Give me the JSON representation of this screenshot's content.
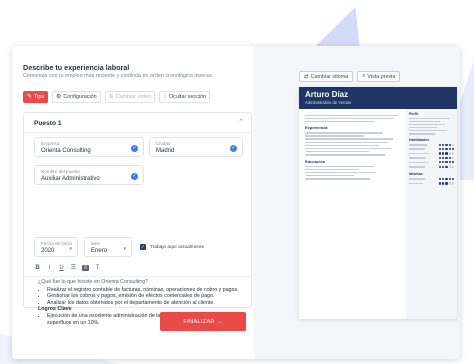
{
  "form": {
    "title": "Describe tu experiencia laboral",
    "subtitle": "Comienza con tu empleo más reciente y continúa en orden cronológico inverso.",
    "toolbar": {
      "tips": "Tips",
      "config": "Configuración",
      "change_order": "Cambiar orden",
      "hide_section": "Ocultar sección"
    },
    "job": {
      "heading": "Puesto 1",
      "empresa_label": "Empresa",
      "empresa_value": "Orienta Consulting",
      "ciudad_label": "Ciudad",
      "ciudad_value": "Madrid",
      "puesto_label": "Nombre del puesto",
      "puesto_value": "Auxiliar Administrativo",
      "fecha_label": "Fecha de inicio",
      "fecha_value": "2020",
      "mes_label": "Mes",
      "mes_value": "Enero",
      "working_label": "Trabajo aquí actualmente",
      "working_checked": true
    },
    "editor": {
      "question": "¿Qué fue lo que hiciste en Orienta Consulting?",
      "bullets": [
        "Realizar el registro contable de facturas, nóminas, operaciones de cobro y pagos.",
        "Gestionar los cobros y pagos, emisión de efectos comerciales de pago.",
        "Analizar los datos obtenidos por el departamento de atención al cliente."
      ],
      "achievements_label": "Logros Clave",
      "achievements": [
        "Ejecución de una excelente administración de la contabilidad, reduciendo los gastos superfluos en un 10%."
      ]
    },
    "finish_button": "FINALIZAR →"
  },
  "preview": {
    "change_template": "Cambiar idioma",
    "full_view": "Vista previa",
    "name": "Arturo Díaz",
    "role": "Administrativo de Ventas",
    "sections": {
      "experience": "Experiencia",
      "education": "Educación",
      "profile": "Perfil",
      "skills": "Habilidades",
      "languages": "Idiomas"
    }
  },
  "colors": {
    "accent": "#e94a4a",
    "navy": "#1f3566",
    "check": "#3c7ce0"
  }
}
